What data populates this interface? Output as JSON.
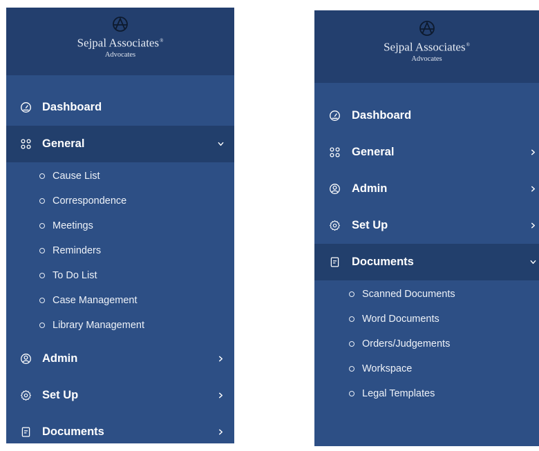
{
  "brand": {
    "name": "Sejpal Associates",
    "registered": "®",
    "tagline": "Advocates"
  },
  "colors": {
    "sidebar_bg": "#2d4f85",
    "header_bg": "#233f6e",
    "active_bg": "#223f6c",
    "text": "#ffffff"
  },
  "left_panel": {
    "items": [
      {
        "label": "Dashboard",
        "icon": "gauge-icon"
      },
      {
        "label": "General",
        "icon": "grid-icon",
        "expanded": true,
        "submenu": [
          "Cause List",
          "Correspondence",
          "Meetings",
          "Reminders",
          "To Do List",
          "Case Management",
          "Library Management"
        ]
      },
      {
        "label": "Admin",
        "icon": "user-circle-icon"
      },
      {
        "label": "Set Up",
        "icon": "gear-icon"
      },
      {
        "label": "Documents",
        "icon": "document-icon"
      }
    ]
  },
  "right_panel": {
    "items": [
      {
        "label": "Dashboard",
        "icon": "gauge-icon"
      },
      {
        "label": "General",
        "icon": "grid-icon"
      },
      {
        "label": "Admin",
        "icon": "user-circle-icon"
      },
      {
        "label": "Set Up",
        "icon": "gear-icon"
      },
      {
        "label": "Documents",
        "icon": "document-icon",
        "expanded": true,
        "submenu": [
          "Scanned Documents",
          "Word Documents",
          "Orders/Judgements",
          "Workspace",
          "Legal Templates"
        ]
      }
    ]
  }
}
